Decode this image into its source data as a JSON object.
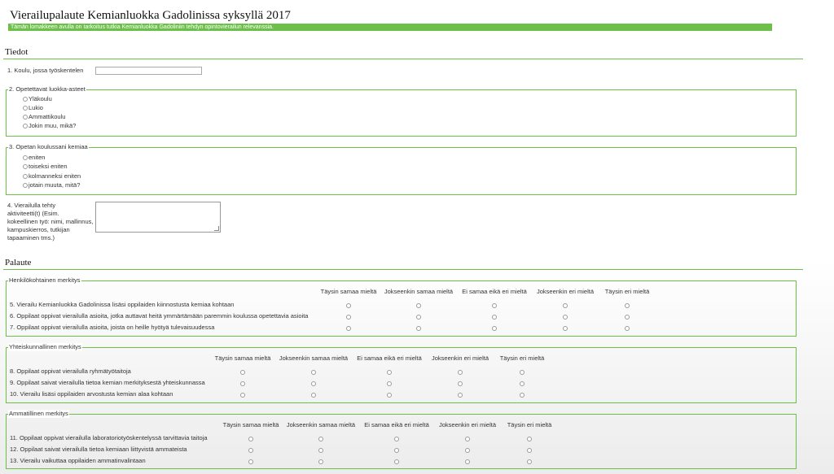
{
  "page": {
    "title": "Vierailupalaute Kemianluokka Gadolinissa syksyllä 2017",
    "subtitle": "Tämän lomakkeen avulla on tarkoitus tutkia Kemianluokka Gadoliniin tehdyn opintovierailun relevanssia."
  },
  "tiedot": {
    "heading": "Tiedot",
    "q1": {
      "label": "1. Koulu, jossa työskentelen",
      "value": ""
    },
    "q2": {
      "legend": "2. Opetettavat luokka-asteet",
      "options": [
        "Yläkoulu",
        "Lukio",
        "Ammattikoulu",
        "Jokin muu, mikä?"
      ]
    },
    "q3": {
      "legend": "3. Opetan koulussani kemiaa",
      "options": [
        "eniten",
        "toiseksi eniten",
        "kolmanneksi eniten",
        "jotain muuta, mitä?"
      ]
    },
    "q4": {
      "label_lines": [
        "4. Vierailulla tehty",
        "aktiviteetti(t) (Esim.",
        "kokeellinen työ: nimi, mallinnus,",
        "kampuskierros, tutkijan",
        "tapaaminen tms.)"
      ],
      "value": ""
    }
  },
  "palaute": {
    "heading": "Palaute",
    "scale": [
      "Täysin samaa mieltä",
      "Jokseenkin samaa mieltä",
      "Ei samaa eikä eri mieltä",
      "Jokseenkin eri mieltä",
      "Täysin eri mieltä"
    ],
    "groups": [
      {
        "legend": "Henkilökohtainen merkitys",
        "rows": [
          "5. Vierailu Kemianluokka Gadolinissa lisäsi oppilaiden kiinnostusta kemiaa kohtaan",
          "6. Oppilaat oppivat vierailulla asioita, jotka auttavat heitä ymmärtämään paremmin koulussa opetettavia asioita",
          "7. Oppilaat oppivat vierailulla asioita, joista on heille hyötyä tulevaisuudessa"
        ]
      },
      {
        "legend": "Yhteiskunnallinen merkitys",
        "rows": [
          "8. Oppilaat oppivat vierailulla ryhmätyötaitoja",
          "9. Oppilaat saivat vierailulla tietoa kemian merkityksestä yhteiskunnassa",
          "10. Vierailu lisäsi oppilaiden arvostusta kemian alaa kohtaan"
        ]
      },
      {
        "legend": "Ammatillinen merkitys",
        "rows": [
          "11. Oppilaat oppivat vierailulla laboratoriotyöskentelyssä tarvittavia taitoja",
          "12. Oppilaat saivat vierailulla tietoa kemiaan liittyvistä ammateista",
          "13. Vierailu vaikuttaa oppilaiden ammatinvalintaan"
        ]
      }
    ]
  },
  "colors": {
    "accent": "#6cc04a"
  }
}
